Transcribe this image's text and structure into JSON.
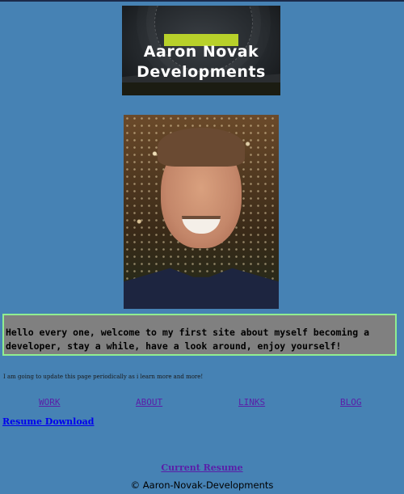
{
  "logo": {
    "line1": "Aaron Novak",
    "line2": "Developments",
    "accent": "#b8d12a"
  },
  "profile_photo": {
    "alt": ""
  },
  "greeting": {
    "text": "Hello every one, welcome to my first site about myself becoming a developer, stay a while, have a look around, enjoy yourself!"
  },
  "note": "I am going to update this page periodically as i learn more and more!",
  "nav": {
    "work": "WORK",
    "about": "ABOUT",
    "links": "LINKS",
    "blog": "BLOG"
  },
  "resume_download": "Resume Download",
  "current_resume": "Current Resume",
  "footer": "© Aaron-Novak-Developments",
  "colors": {
    "background": "#4682b4",
    "greeting_box": "#808080",
    "greeting_border": "#90ee90",
    "visited_link": "#5a1fa8",
    "link": "#0000ee"
  }
}
